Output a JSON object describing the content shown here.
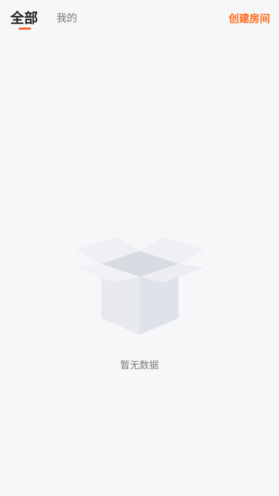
{
  "header": {
    "tabs": [
      {
        "label": "全部",
        "active": true
      },
      {
        "label": "我的",
        "active": false
      }
    ],
    "create_room_label": "创建房间"
  },
  "empty_state": {
    "icon": "open-box-icon",
    "message": "暂无数据"
  },
  "colors": {
    "accent": "#ff6a1a",
    "background": "#f6f7f9",
    "text_primary": "#222222",
    "text_secondary": "#777777"
  }
}
